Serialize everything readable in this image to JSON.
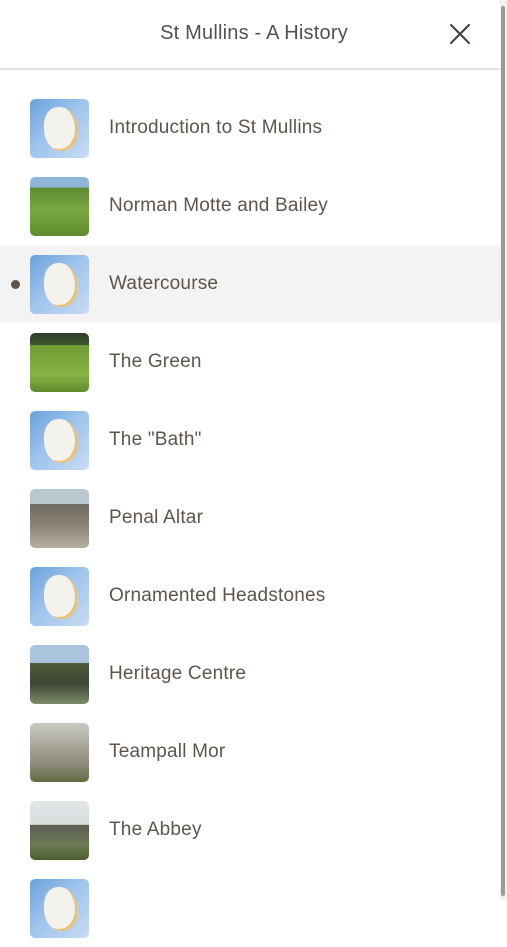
{
  "header": {
    "title": "St Mullins - A History"
  },
  "items": [
    {
      "label": "Introduction to St Mullins",
      "thumb": "map",
      "active": false
    },
    {
      "label": "Norman Motte and Bailey",
      "thumb": "mound",
      "active": false
    },
    {
      "label": "Watercourse",
      "thumb": "map",
      "active": true
    },
    {
      "label": "The Green",
      "thumb": "green",
      "active": false
    },
    {
      "label": "The \"Bath\"",
      "thumb": "map",
      "active": false
    },
    {
      "label": "Penal Altar",
      "thumb": "altar",
      "active": false
    },
    {
      "label": "Ornamented Headstones",
      "thumb": "map",
      "active": false
    },
    {
      "label": "Heritage Centre",
      "thumb": "heritage",
      "active": false
    },
    {
      "label": "Teampall Mor",
      "thumb": "teampall",
      "active": false
    },
    {
      "label": "The Abbey",
      "thumb": "abbey",
      "active": false
    },
    {
      "label": "",
      "thumb": "map",
      "active": false
    }
  ],
  "icons": {
    "close": "close-icon",
    "bullet": "current-item-bullet"
  },
  "colors": {
    "text": "#5e554c",
    "active_bg": "#f3f3f3"
  }
}
